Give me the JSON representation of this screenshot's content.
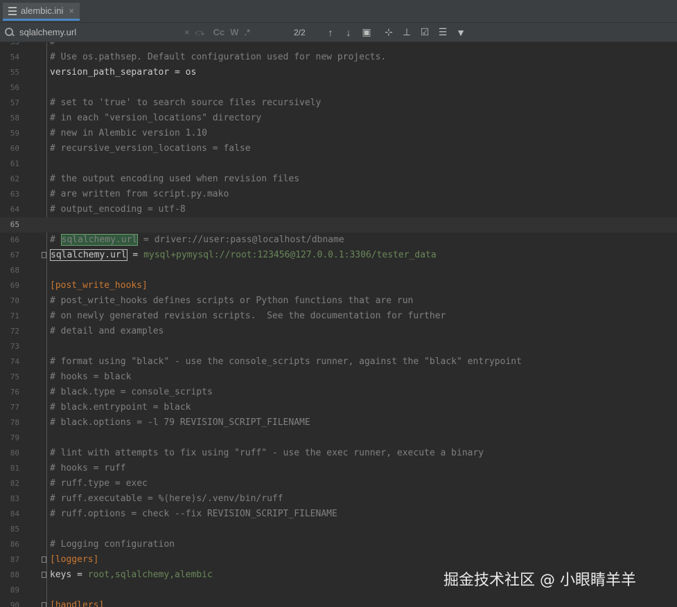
{
  "tab": {
    "filename": "alembic.ini",
    "close": "×"
  },
  "search": {
    "query": "sqlalchemy.url",
    "clear": "×",
    "match_case": "Cc",
    "words": "W",
    "regex": ".*",
    "count": "2/2"
  },
  "lines": [
    {
      "n": "53",
      "parts": [
        {
          "t": "#",
          "c": "comment"
        }
      ]
    },
    {
      "n": "54",
      "parts": [
        {
          "t": "# Use os.pathsep. Default configuration used for new projects.",
          "c": "comment"
        }
      ]
    },
    {
      "n": "55",
      "parts": [
        {
          "t": "version_path_separator",
          "c": "key"
        },
        {
          "t": " = ",
          "c": "key"
        },
        {
          "t": "os",
          "c": "key"
        }
      ]
    },
    {
      "n": "56",
      "parts": []
    },
    {
      "n": "57",
      "parts": [
        {
          "t": "# set to 'true' to search source files recursively",
          "c": "comment"
        }
      ]
    },
    {
      "n": "58",
      "parts": [
        {
          "t": "# in each \"version_locations\" directory",
          "c": "comment"
        }
      ]
    },
    {
      "n": "59",
      "parts": [
        {
          "t": "# new in Alembic version 1.10",
          "c": "comment"
        }
      ]
    },
    {
      "n": "60",
      "parts": [
        {
          "t": "# recursive_version_locations = false",
          "c": "comment"
        }
      ]
    },
    {
      "n": "61",
      "parts": []
    },
    {
      "n": "62",
      "parts": [
        {
          "t": "# the output encoding used when revision files",
          "c": "comment"
        }
      ]
    },
    {
      "n": "63",
      "parts": [
        {
          "t": "# are written from script.py.mako",
          "c": "comment"
        }
      ]
    },
    {
      "n": "64",
      "parts": [
        {
          "t": "# output_encoding = utf-8",
          "c": "comment"
        }
      ]
    },
    {
      "n": "65",
      "parts": [],
      "current": true
    },
    {
      "n": "66",
      "parts": [
        {
          "t": "# ",
          "c": "comment"
        },
        {
          "t": "sqlalchemy.url",
          "c": "hl"
        },
        {
          "t": " = driver://user:pass@localhost/dbname",
          "c": "comment"
        }
      ]
    },
    {
      "n": "67",
      "fold": true,
      "parts": [
        {
          "t": "sqlalchemy.url",
          "c": "key hl-key"
        },
        {
          "t": " = ",
          "c": "key"
        },
        {
          "t": "mysql+pymysql://root:123456@127.0.0.1:3306/tester_data",
          "c": "val"
        }
      ]
    },
    {
      "n": "68",
      "parts": []
    },
    {
      "n": "69",
      "parts": [
        {
          "t": "[post_write_hooks]",
          "c": "section"
        }
      ]
    },
    {
      "n": "70",
      "parts": [
        {
          "t": "# post_write_hooks defines scripts or Python functions that are run",
          "c": "comment"
        }
      ]
    },
    {
      "n": "71",
      "parts": [
        {
          "t": "# on newly generated revision scripts.  See the documentation for further",
          "c": "comment"
        }
      ]
    },
    {
      "n": "72",
      "parts": [
        {
          "t": "# detail and examples",
          "c": "comment"
        }
      ]
    },
    {
      "n": "73",
      "parts": []
    },
    {
      "n": "74",
      "parts": [
        {
          "t": "# format using \"black\" - use the console_scripts runner, against the \"black\" entrypoint",
          "c": "comment"
        }
      ]
    },
    {
      "n": "75",
      "parts": [
        {
          "t": "# hooks = black",
          "c": "comment"
        }
      ]
    },
    {
      "n": "76",
      "parts": [
        {
          "t": "# black.type = console_scripts",
          "c": "comment"
        }
      ]
    },
    {
      "n": "77",
      "parts": [
        {
          "t": "# black.entrypoint = black",
          "c": "comment"
        }
      ]
    },
    {
      "n": "78",
      "parts": [
        {
          "t": "# black.options = -l 79 REVISION_SCRIPT_FILENAME",
          "c": "comment"
        }
      ]
    },
    {
      "n": "79",
      "parts": []
    },
    {
      "n": "80",
      "parts": [
        {
          "t": "# lint with attempts to fix using \"ruff\" - use the exec runner, execute a binary",
          "c": "comment"
        }
      ]
    },
    {
      "n": "81",
      "parts": [
        {
          "t": "# hooks = ruff",
          "c": "comment"
        }
      ]
    },
    {
      "n": "82",
      "parts": [
        {
          "t": "# ruff.type = exec",
          "c": "comment"
        }
      ]
    },
    {
      "n": "83",
      "parts": [
        {
          "t": "# ruff.executable = %(here)s/.venv/bin/ruff",
          "c": "comment"
        }
      ]
    },
    {
      "n": "84",
      "parts": [
        {
          "t": "# ruff.options = check --fix REVISION_SCRIPT_FILENAME",
          "c": "comment"
        }
      ]
    },
    {
      "n": "85",
      "parts": []
    },
    {
      "n": "86",
      "parts": [
        {
          "t": "# Logging configuration",
          "c": "comment"
        }
      ]
    },
    {
      "n": "87",
      "fold": true,
      "parts": [
        {
          "t": "[loggers]",
          "c": "section"
        }
      ]
    },
    {
      "n": "88",
      "fold": true,
      "parts": [
        {
          "t": "keys",
          "c": "key"
        },
        {
          "t": " = ",
          "c": "key"
        },
        {
          "t": "root,sqlalchemy,alembic",
          "c": "val"
        }
      ]
    },
    {
      "n": "89",
      "parts": []
    },
    {
      "n": "90",
      "fold": true,
      "parts": [
        {
          "t": "[handlers]",
          "c": "section"
        }
      ]
    }
  ],
  "watermark": "掘金技术社区 @ 小眼睛羊羊"
}
